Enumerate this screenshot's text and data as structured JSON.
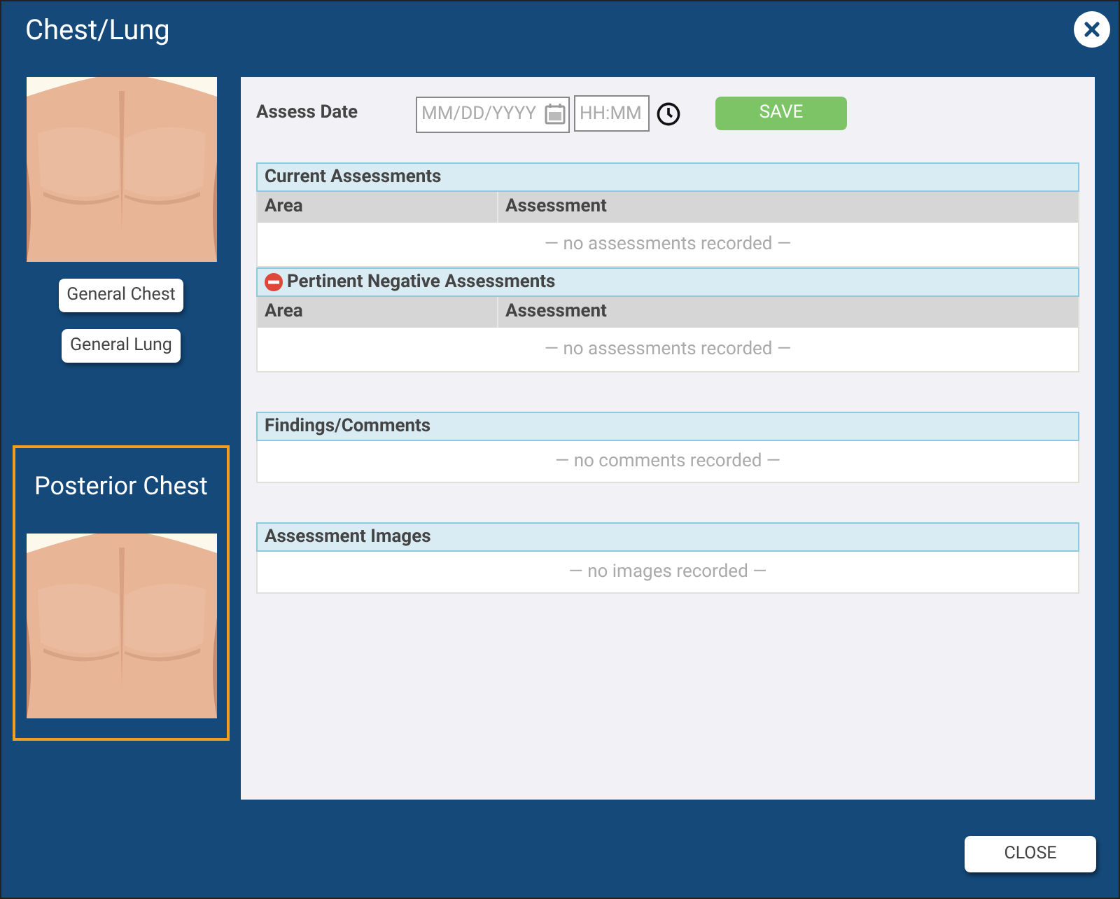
{
  "window": {
    "title": "Chest/Lung"
  },
  "views": [
    {
      "selected": false,
      "buttons": [
        "General Chest",
        "General Lung"
      ]
    },
    {
      "selected": true,
      "title": "Posterior Chest"
    }
  ],
  "assess": {
    "label": "Assess Date",
    "date_placeholder": "MM/DD/YYYY",
    "time_placeholder": "HH:MM",
    "save": "SAVE"
  },
  "sections": [
    {
      "kind": "table",
      "title": "Current Assessments",
      "negative": false,
      "columns": [
        "Area",
        "Assessment"
      ],
      "empty": "— no assessments recorded —"
    },
    {
      "kind": "table",
      "title": "Pertinent Negative Assessments",
      "negative": true,
      "columns": [
        "Area",
        "Assessment"
      ],
      "empty": "— no assessments recorded —"
    },
    {
      "kind": "list",
      "title": "Findings/Comments",
      "negative": false,
      "empty": "— no comments recorded —"
    },
    {
      "kind": "list",
      "title": "Assessment Images",
      "negative": false,
      "empty": "— no images recorded —"
    }
  ],
  "close_button": "CLOSE"
}
